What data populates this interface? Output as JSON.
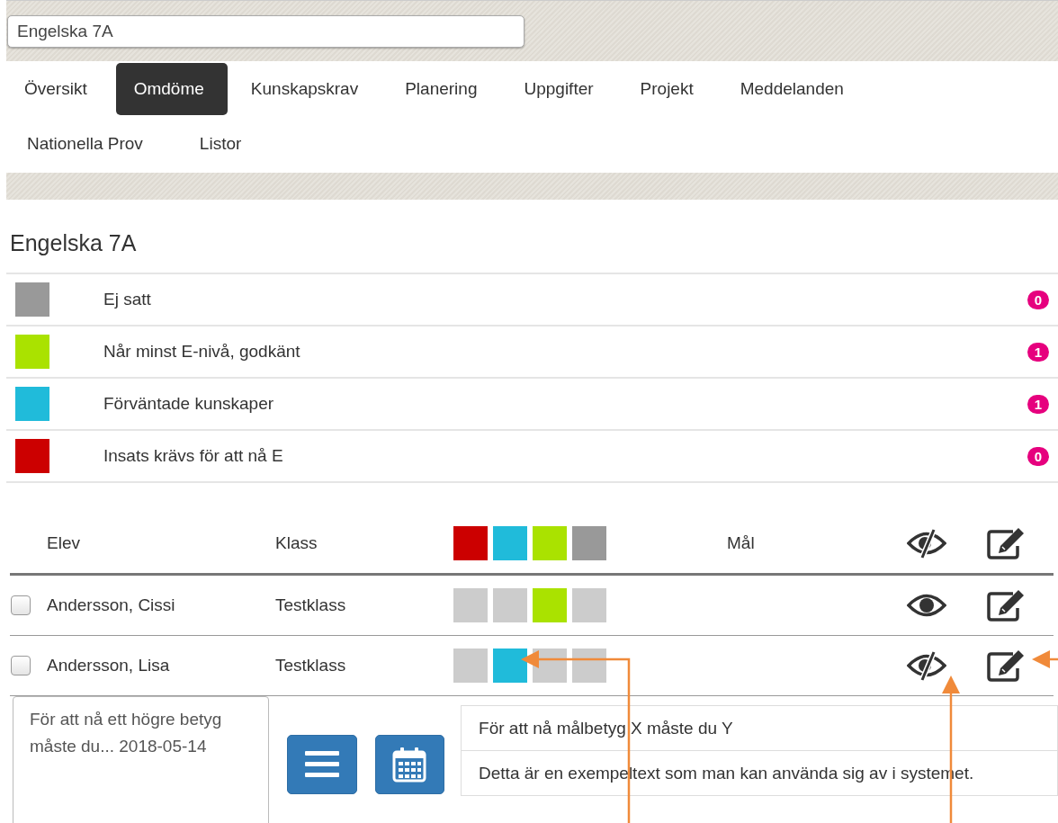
{
  "search": {
    "value": "Engelska 7A"
  },
  "tabs": [
    {
      "label": "Översikt",
      "selected": false
    },
    {
      "label": "Omdöme",
      "selected": true
    },
    {
      "label": "Kunskapskrav",
      "selected": false
    },
    {
      "label": "Planering",
      "selected": false
    },
    {
      "label": "Uppgifter",
      "selected": false
    },
    {
      "label": "Projekt",
      "selected": false
    },
    {
      "label": "Meddelanden",
      "selected": false
    },
    {
      "label": "Nationella Prov",
      "selected": false
    },
    {
      "label": "Listor",
      "selected": false
    }
  ],
  "title": "Engelska 7A",
  "legend": [
    {
      "label": "Ej satt",
      "color": "#999999",
      "count": "0"
    },
    {
      "label": "Når minst E-nivå, godkänt",
      "color": "#aae200",
      "count": "1"
    },
    {
      "label": "Förväntade kunskaper",
      "color": "#20bbda",
      "count": "1"
    },
    {
      "label": "Insats krävs för att nå E",
      "color": "#cc0000",
      "count": "0"
    }
  ],
  "table": {
    "columns": {
      "student": "Elev",
      "class": "Klass",
      "goal": "Mål"
    },
    "header_squares": [
      {
        "color": "#cc0000"
      },
      {
        "color": "#20bbda"
      },
      {
        "color": "#aae200"
      },
      {
        "color": "#999999"
      }
    ],
    "header_visible": false,
    "rows": [
      {
        "checked": false,
        "student": "Andersson, Cissi",
        "class": "Testklass",
        "squares": [
          {
            "selected": false
          },
          {
            "selected": false
          },
          {
            "selected": true
          },
          {
            "selected": false
          }
        ],
        "visible": true
      },
      {
        "checked": false,
        "student": "Andersson, Lisa",
        "class": "Testklass",
        "squares": [
          {
            "selected": false
          },
          {
            "selected": true
          },
          {
            "selected": false
          },
          {
            "selected": false
          }
        ],
        "visible": false
      }
    ]
  },
  "note": {
    "value": "För att nå ett högre betyg måste du... 2018-05-14"
  },
  "suggestions": [
    "För att nå målbetyg X måste du Y",
    "Detta är en exempeltext som man kan använda sig av i systemet."
  ]
}
